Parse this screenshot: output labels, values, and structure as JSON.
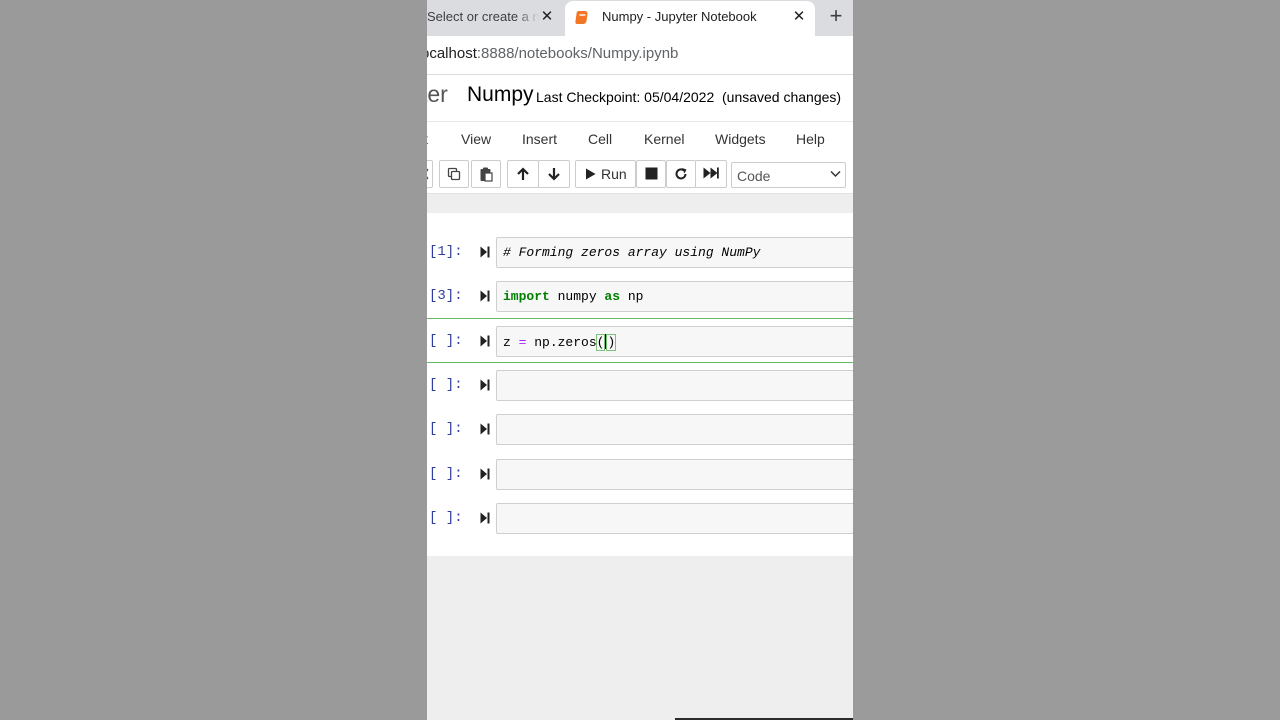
{
  "browser": {
    "tabs": [
      {
        "title": "Select or create a notebook",
        "close": "✕"
      },
      {
        "title": "Numpy - Jupyter Notebook",
        "close": "✕"
      }
    ],
    "new_tab": "+",
    "url_host": "ocalhost",
    "url_path": ":8888/notebooks/Numpy.ipynb"
  },
  "jupyter": {
    "logo_text": "ter",
    "notebook_name": "Numpy",
    "checkpoint": "Last Checkpoint: 05/04/2022",
    "status": "(unsaved changes)",
    "menu": [
      "t",
      "View",
      "Insert",
      "Cell",
      "Kernel",
      "Widgets",
      "Help"
    ],
    "toolbar": {
      "run_label": "Run",
      "cell_type": "Code"
    }
  },
  "cells": [
    {
      "prompt": "[1]:",
      "code": "# Forming zeros array using NumPy"
    },
    {
      "prompt": "[3]:",
      "code": "import numpy as np"
    },
    {
      "prompt": "[ ]:",
      "code": "z = np.zeros()"
    },
    {
      "prompt": "[ ]:",
      "code": ""
    },
    {
      "prompt": "[ ]:",
      "code": ""
    },
    {
      "prompt": "[ ]:",
      "code": ""
    },
    {
      "prompt": "[ ]:",
      "code": ""
    }
  ],
  "colors": {
    "prompt_in": "#303f9f",
    "selected_border": "#66bb6a",
    "comment": "#408080",
    "keyword": "#008000",
    "operator": "#aa22ff",
    "jupyter_orange": "#f37626"
  },
  "icons": [
    "close-icon",
    "plus-icon",
    "jupyter-favicon",
    "copy-icon",
    "paste-icon",
    "arrow-up-icon",
    "arrow-down-icon",
    "play-icon",
    "stop-icon",
    "restart-icon",
    "fast-forward-icon",
    "chevron-down-icon",
    "run-cell-icon"
  ]
}
